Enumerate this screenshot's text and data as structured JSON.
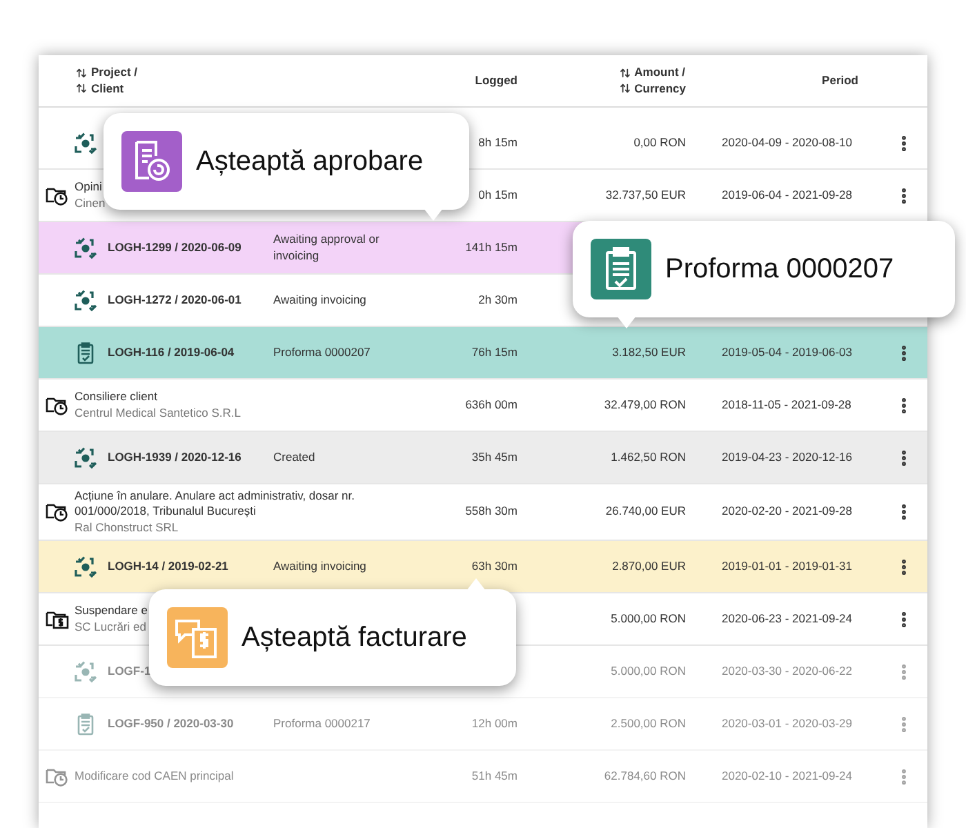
{
  "header": {
    "project": "Project /",
    "client": "Client",
    "logged": "Logged",
    "amount": "Amount /",
    "currency": "Currency",
    "period": "Period"
  },
  "rows": [
    {
      "kind": "log",
      "id": "",
      "status": "",
      "logged": "8h 15m",
      "amount": "0,00 RON",
      "period": "2020-04-09 - 2020-08-10",
      "color": null,
      "faded": false
    },
    {
      "kind": "project",
      "title": "Opini",
      "client": "Cinen",
      "logged": "0h 15m",
      "amount": "32.737,50 EUR",
      "period": "2019-06-04 - 2021-09-28",
      "color": null,
      "faded": false
    },
    {
      "kind": "log",
      "id": "LOGH-1299 / 2020-06-09",
      "status": "Awaiting approval or invoicing",
      "logged": "141h 15m",
      "amount": "",
      "period": "",
      "color": "#f3d3f8",
      "faded": false
    },
    {
      "kind": "log",
      "id": "LOGH-1272 / 2020-06-01",
      "status": "Awaiting invoicing",
      "logged": "2h 30m",
      "amount": "",
      "period": "",
      "color": null,
      "faded": false
    },
    {
      "kind": "proforma",
      "id": "LOGH-116 / 2019-06-04",
      "status": "Proforma 0000207",
      "logged": "76h 15m",
      "amount": "3.182,50 EUR",
      "period": "2019-05-04 - 2019-06-03",
      "color": "#a9ddd6",
      "faded": false
    },
    {
      "kind": "project",
      "title": "Consiliere client",
      "client": "Centrul Medical Santetico S.R.L",
      "logged": "636h 00m",
      "amount": "32.479,00 RON",
      "period": "2018-11-05 - 2021-09-28",
      "color": null,
      "faded": false
    },
    {
      "kind": "log",
      "id": "LOGH-1939 / 2020-12-16",
      "status": "Created",
      "logged": "35h 45m",
      "amount": "1.462,50 RON",
      "period": "2019-04-23 - 2020-12-16",
      "color": "#ececec",
      "faded": false
    },
    {
      "kind": "project",
      "title": "Acțiune în anulare. Anulare act administrativ, dosar nr. 001/000/2018, Tribunalul București",
      "client": "Ral Chonstruct SRL",
      "logged": "558h 30m",
      "amount": "26.740,00 EUR",
      "period": "2020-02-20 - 2021-09-28",
      "color": null,
      "faded": false
    },
    {
      "kind": "log",
      "id": "LOGH-14 / 2019-02-21",
      "status": "Awaiting invoicing",
      "logged": "63h 30m",
      "amount": "2.870,00 EUR",
      "period": "2019-01-01 - 2019-01-31",
      "color": "#fcf1cb",
      "faded": false
    },
    {
      "kind": "billing",
      "title": "Suspendare e",
      "client": "SC Lucrări ed",
      "logged": "",
      "amount": "5.000,00 RON",
      "period": "2020-06-23 - 2021-09-24",
      "color": null,
      "faded": false
    },
    {
      "kind": "log",
      "id": "LOGF-1",
      "status": "",
      "logged": "",
      "amount": "5.000,00 RON",
      "period": "2020-03-30 - 2020-06-22",
      "color": null,
      "faded": true
    },
    {
      "kind": "proforma",
      "id": "LOGF-950 / 2020-03-30",
      "status": "Proforma 0000217",
      "logged": "12h 00m",
      "amount": "2.500,00 RON",
      "period": "2020-03-01 - 2020-03-29",
      "color": null,
      "faded": true
    },
    {
      "kind": "project",
      "title": "Modificare cod CAEN principal",
      "client": "",
      "logged": "51h 45m",
      "amount": "62.784,60 RON",
      "period": "2020-02-10 - 2021-09-24",
      "color": null,
      "faded": true
    }
  ],
  "callouts": [
    {
      "kind": "approval",
      "text": "Așteaptă aprobare",
      "color": "#a35fc9"
    },
    {
      "kind": "proforma",
      "text": "Proforma 0000207",
      "color": "#2f8b79"
    },
    {
      "kind": "invoicing",
      "text": "Așteaptă facturare",
      "color": "#f7b45c"
    }
  ]
}
